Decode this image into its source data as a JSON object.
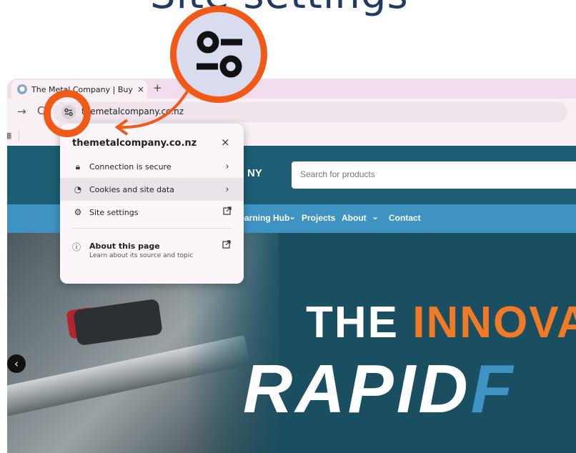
{
  "heading": {
    "text": "Site settings"
  },
  "browser": {
    "tab": {
      "title": "The Metal Company | Buy Stainless",
      "close": "×"
    },
    "new_tab": "+",
    "url": "themetalcompany.co.nz"
  },
  "site": {
    "logo_tail": "NY",
    "search_placeholder": "Search for products",
    "nav": [
      {
        "label": "Learning Hub"
      },
      {
        "label": "Projects"
      },
      {
        "label": "About"
      },
      {
        "label": "Contact"
      }
    ],
    "hero": {
      "line1_prefix": "THE ",
      "line1_accent": "INNOVA",
      "line2_prefix": "RAPID",
      "line2_accent": "F"
    }
  },
  "popup": {
    "domain": "themetalcompany.co.nz",
    "close": "×",
    "rows": [
      {
        "icon": "lock-icon",
        "label": "Connection is secure",
        "trailing": "›"
      },
      {
        "icon": "cookie-icon",
        "label": "Cookies and site data",
        "trailing": "›",
        "highlighted": true
      },
      {
        "icon": "settings-icon",
        "label": "Site settings",
        "trailing": "open-external-icon"
      }
    ],
    "about": {
      "title": "About this page",
      "subtitle": "Learn about its source and topic"
    }
  },
  "colors": {
    "callout": "#f15a16",
    "site_primary": "#1c5d74",
    "nav": "#3f93c3",
    "accent_orange": "#f07a26"
  }
}
